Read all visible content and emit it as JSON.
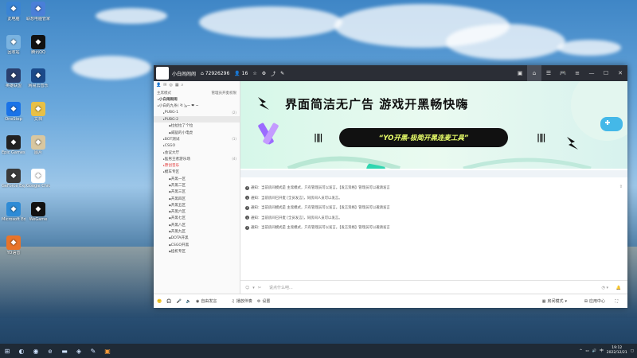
{
  "desktop_icons": [
    {
      "label": "此电脑",
      "icon": "computer-icon",
      "color": "#3a84d4"
    },
    {
      "label": "联想电脑管家",
      "icon": "lenovo-icon",
      "color": "#4a7fd8"
    },
    {
      "label": "回收站",
      "icon": "recycle-bin-icon",
      "color": "#7ab3e0"
    },
    {
      "label": "腾讯QQ",
      "icon": "qq-icon",
      "color": "#111111"
    },
    {
      "label": "英雄联盟",
      "icon": "lol-icon",
      "color": "#2a3f6e"
    },
    {
      "label": "网易云音乐",
      "icon": "browser-icon",
      "color": "#1b4a8a"
    },
    {
      "label": "OneStep",
      "icon": "onestep-icon",
      "color": "#1a73e8"
    },
    {
      "label": "文档",
      "icon": "doc-icon",
      "color": "#e8c046"
    },
    {
      "label": "Epic Games Launcher",
      "icon": "epic-icon",
      "color": "#222222"
    },
    {
      "label": "图片",
      "icon": "image-icon",
      "color": "#d8c7a0"
    },
    {
      "label": "GeForce Experience",
      "icon": "nvidia-icon",
      "color": "#3a3a3a"
    },
    {
      "label": "Google Chrome",
      "icon": "chrome-icon",
      "color": "#ffffff"
    },
    {
      "label": "Microsoft Edge",
      "icon": "edge-icon",
      "color": "#2e8bd6"
    },
    {
      "label": "WeGame",
      "icon": "wegame-icon",
      "color": "#111111"
    },
    {
      "label": "YO语音",
      "icon": "yo-icon",
      "color": "#e8742a"
    }
  ],
  "window": {
    "title": "小白闹闹闹",
    "room_id": "72926296",
    "online": "16",
    "left": {
      "mode": "主席模式",
      "manage": "管理员开麦权限",
      "channels": [
        {
          "label": "小白闹闹闹",
          "level": 0,
          "bold": true
        },
        {
          "label": "小白的九条( ᐛ )و~ ❤ ~",
          "level": 0
        },
        {
          "label": "PUBG-1",
          "level": 1,
          "num": "(2)"
        },
        {
          "label": "PUBG-2",
          "level": 1,
          "selected": true
        },
        {
          "label": "拉拉拉了个拉",
          "level": 2
        },
        {
          "label": "威猛的小电虎",
          "level": 2
        },
        {
          "label": "BOT测试",
          "level": 1,
          "num": "(1)"
        },
        {
          "label": "CSGO",
          "level": 1
        },
        {
          "label": "会议大厅",
          "level": 1
        },
        {
          "label": "猛男王者游乐场",
          "level": 1,
          "num": "(4)"
        },
        {
          "label": "原创音乐",
          "level": 1,
          "red": true
        },
        {
          "label": "模车专区",
          "level": 1
        },
        {
          "label": "开黑一区",
          "level": 2
        },
        {
          "label": "开黑二区",
          "level": 2
        },
        {
          "label": "开黑三区",
          "level": 2
        },
        {
          "label": "开黑四区",
          "level": 2
        },
        {
          "label": "开黑五区",
          "level": 2
        },
        {
          "label": "开黑六区",
          "level": 2
        },
        {
          "label": "开黑七区",
          "level": 2
        },
        {
          "label": "开黑八区",
          "level": 2
        },
        {
          "label": "开黑九区",
          "level": 2
        },
        {
          "label": "DOTA开黑",
          "level": 2
        },
        {
          "label": "CSGO开黑",
          "level": 2
        },
        {
          "label": "挂机专区",
          "level": 2
        }
      ]
    },
    "banner": {
      "headline": "界面简洁无广告 游戏开黑畅快嗨",
      "pill": "“YO开黑-极简开黑连麦工具”"
    },
    "messages": [
      "通知：当前房间模式是 主席模式，只有管理员可以发言。【发言资格】管理员可以邀请发言",
      "通知：当前房间已开麦 [全员发言]，同房间人员可以发言。",
      "通知：当前房间模式是 主席模式，只有管理员可以发言。【发言资格】管理员可以邀请发言",
      "通知：当前房间已开麦 [全员发言]，同房间人员可以发言。",
      "通知：当前房间模式是 主席模式，只有管理员可以发言。【发言资格】管理员可以邀请发言"
    ],
    "input_placeholder": "说点什么吧...",
    "bottom": {
      "open_mic": "自由发言",
      "music": "播放伴奏",
      "settings": "设置",
      "room_mode": "房间模式",
      "app_center": "应用中心"
    }
  },
  "taskbar": {
    "time": "19:12",
    "date": "2022/12/21"
  }
}
